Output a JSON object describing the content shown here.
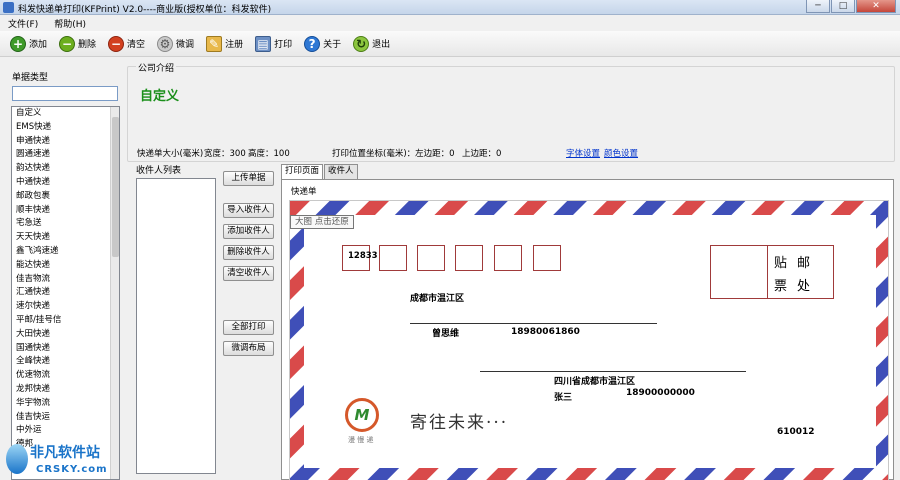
{
  "window": {
    "title": "科发快递单打印(KFPrint) V2.0----商业版(授权单位：科发软件)",
    "minimize": "─",
    "maximize": "□",
    "close": "✕"
  },
  "menu": [
    "文件(F)",
    "帮助(H)"
  ],
  "toolbar": {
    "add": {
      "label": "添加",
      "icon": "+"
    },
    "delete": {
      "label": "删除",
      "icon": "−"
    },
    "clear": {
      "label": "清空",
      "icon": "−"
    },
    "tune": {
      "label": "微调",
      "icon": "⚙"
    },
    "register": {
      "label": "注册",
      "icon": "✎"
    },
    "print": {
      "label": "打印",
      "icon": "▤"
    },
    "about": {
      "label": "关于",
      "icon": "?"
    },
    "exit": {
      "label": "退出",
      "icon": "↻"
    }
  },
  "left": {
    "label": "单据类型",
    "search_value": "",
    "items": [
      "自定义",
      "EMS快递",
      "申通快递",
      "圆通速递",
      "韵达快递",
      "中通快递",
      "邮政包裹",
      "顺丰快递",
      "宅急送",
      "天天快递",
      "鑫飞鸿速递",
      "能达快递",
      "佳吉物流",
      "汇通快递",
      "速尔快递",
      "平邮/挂号信",
      "大田快递",
      "国通快递",
      "全峰快递",
      "优速物流",
      "龙邦快递",
      "华宇物流",
      "佳吉快运",
      "中外运",
      "德邦"
    ]
  },
  "company": {
    "group_label": "公司介绍",
    "name": "自定义",
    "size_label": "快递单大小(毫米)",
    "width_text": "宽度：300",
    "height_text": "高度：100",
    "offset_left_text": "打印位置坐标(毫米)：左边距：0",
    "offset_top_text": "上边距：0",
    "font_link": "字体设置",
    "color_link": "颜色设置"
  },
  "recipients": {
    "group_label": "收件人列表",
    "buttons": {
      "upload": "上传单据",
      "import": "导入收件人",
      "add": "添加收件人",
      "delete": "删除收件人",
      "clear": "清空收件人",
      "print_all": "全部打印",
      "layout": "微调布局"
    }
  },
  "tabs": [
    "打印页面",
    "收件人"
  ],
  "preview": {
    "group_label": "快递单",
    "tooltip": "大图 点击还原",
    "sender_zip": "12833",
    "stamp_line1": "贴邮",
    "stamp_line2": "票处",
    "sender_address": "成都市温江区",
    "sender_name": "曾思维",
    "sender_phone": "18980061860",
    "receiver_address": "四川省成都市温江区",
    "receiver_name": "张三",
    "receiver_phone": "18900000000",
    "receiver_zip": "610012",
    "logo_letter": "M",
    "logo_sub": "漫 慢 递",
    "slogan": "寄往未来···"
  },
  "watermark": {
    "title": "非凡软件站",
    "sub": "CRSKY.com"
  },
  "colors": {
    "airmail_red": "#d94a4a",
    "airmail_blue": "#3f4fb8",
    "company_name": "#1a8f1a",
    "link": "#0033cc"
  }
}
